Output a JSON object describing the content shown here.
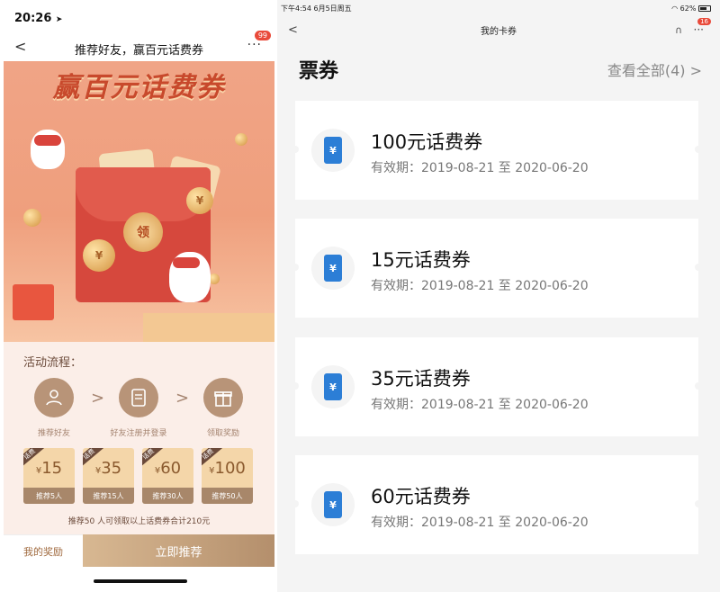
{
  "left": {
    "status": {
      "time": "20:26",
      "time_glyph": "➤"
    },
    "nav": {
      "back": "<",
      "title": "推荐好友，赢百元话费券",
      "more": "···",
      "badge": "99"
    },
    "hero": {
      "title": "赢百元话费券",
      "coin_label": "领"
    },
    "process": {
      "title": "活动流程：",
      "steps": [
        {
          "label": "推荐好友",
          "icon": "user-add-icon"
        },
        {
          "label": "好友注册并登录",
          "icon": "document-icon"
        },
        {
          "label": "领取奖励",
          "icon": "gift-icon"
        }
      ],
      "arrow": ">",
      "tickets": [
        {
          "tag": "话费",
          "currency": "¥",
          "amount": "15",
          "sub": "推荐5人"
        },
        {
          "tag": "话费",
          "currency": "¥",
          "amount": "35",
          "sub": "推荐15人"
        },
        {
          "tag": "话费",
          "currency": "¥",
          "amount": "60",
          "sub": "推荐30人"
        },
        {
          "tag": "话费",
          "currency": "¥",
          "amount": "100",
          "sub": "推荐50人"
        }
      ],
      "footnote": "推荐50 人可领取以上话费券合计210元"
    },
    "bottom": {
      "mine": "我的奖励",
      "go": "立即推荐"
    }
  },
  "right": {
    "status": {
      "left": "下午4:54  6月5日周五",
      "battery": "62%"
    },
    "nav": {
      "back": "<",
      "title": "我的卡券",
      "head_icon": "∩",
      "more": "···",
      "badge": "16"
    },
    "section": {
      "title": "票券",
      "view_all": "查看全部(4) >"
    },
    "coupons": [
      {
        "name": "100元话费券",
        "validity": "有效期：2019-08-21 至 2020-06-20",
        "icon_glyph": "¥"
      },
      {
        "name": "15元话费券",
        "validity": "有效期：2019-08-21 至 2020-06-20",
        "icon_glyph": "¥"
      },
      {
        "name": "35元话费券",
        "validity": "有效期：2019-08-21 至 2020-06-20",
        "icon_glyph": "¥"
      },
      {
        "name": "60元话费券",
        "validity": "有效期：2019-08-21 至 2020-06-20",
        "icon_glyph": "¥"
      }
    ]
  },
  "colors": {
    "accent_gold": "#b48f6c",
    "hero_bg": "#ef9f7d",
    "phone_icon_blue": "#2c7ed6",
    "badge_red": "#e94a3a"
  }
}
